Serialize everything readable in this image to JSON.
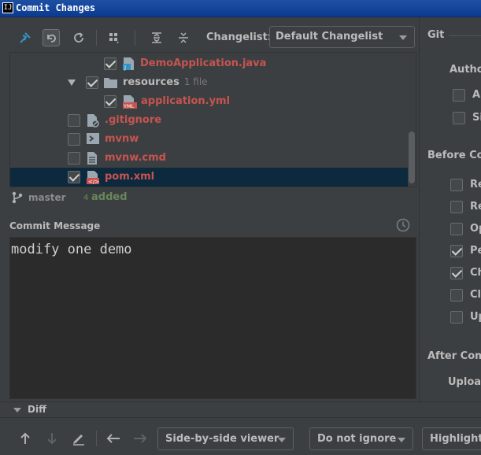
{
  "window": {
    "logo_text": "IJ",
    "title": "Commit Changes"
  },
  "toolbar": {
    "changelist_label": "Changelist:",
    "changelist_value": "Default Changelist"
  },
  "tree": {
    "rows": [
      {
        "name": "DemoApplication.java",
        "type": "java",
        "checked": true
      },
      {
        "name": "resources",
        "type": "folder",
        "checked": true,
        "count": "1 file"
      },
      {
        "name": "application.yml",
        "type": "yml",
        "checked": true
      },
      {
        "name": ".gitignore",
        "type": "ignore",
        "checked": false
      },
      {
        "name": "mvnw",
        "type": "shell",
        "checked": false
      },
      {
        "name": "mvnw.cmd",
        "type": "text",
        "checked": false
      },
      {
        "name": "pom.xml",
        "type": "xml",
        "checked": true,
        "selected": true
      }
    ]
  },
  "status": {
    "branch": "master",
    "added_count": "4",
    "added_label": "added"
  },
  "commit": {
    "label": "Commit Message",
    "message": "modify one demo"
  },
  "right_panel": {
    "git_title": "Git",
    "author_title": "Autho",
    "author_items": [
      "A",
      "Si"
    ],
    "before_title": "Before Com",
    "before_items": [
      {
        "label": "Re",
        "checked": false
      },
      {
        "label": "Re",
        "checked": false
      },
      {
        "label": "Op",
        "checked": false
      },
      {
        "label": "Pe",
        "checked": true
      },
      {
        "label": "Ch",
        "checked": true
      },
      {
        "label": "Cl",
        "checked": false
      },
      {
        "label": "Up",
        "checked": false
      }
    ],
    "after_title": "After Comm",
    "upload_label": "Uploa"
  },
  "diff": {
    "label": "Diff",
    "viewer": "Side-by-side viewer",
    "ignore": "Do not ignore",
    "highlight": "Highlight"
  },
  "colors": {
    "modified_file": "#c75450",
    "added": "#6a8759",
    "selection": "#0d293e",
    "editor_bg": "#2b2b2b"
  }
}
